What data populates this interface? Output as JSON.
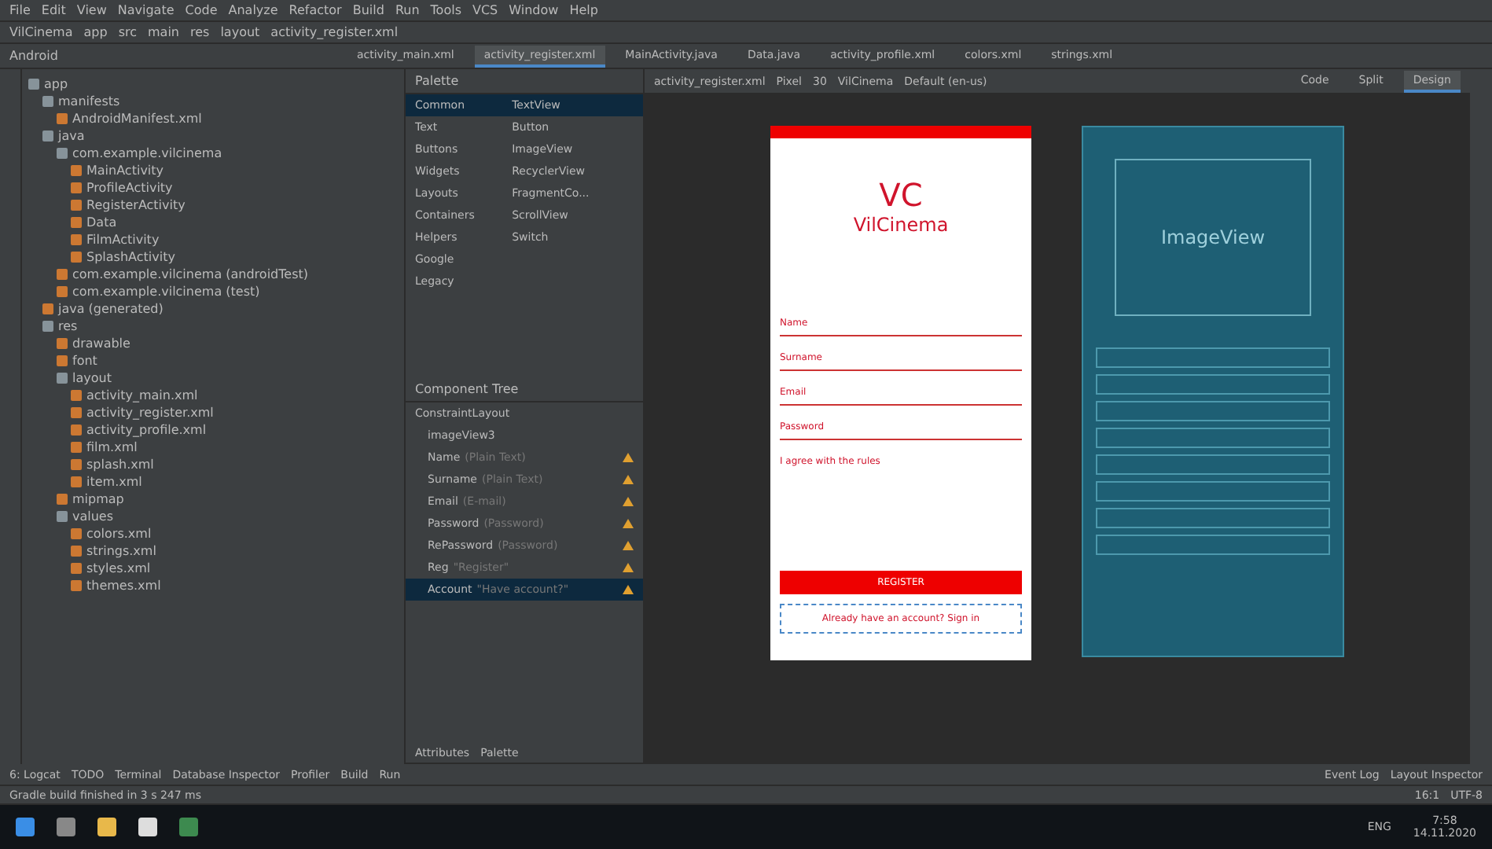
{
  "menu": [
    "File",
    "Edit",
    "View",
    "Navigate",
    "Code",
    "Analyze",
    "Refactor",
    "Build",
    "Run",
    "Tools",
    "VCS",
    "Window",
    "Help"
  ],
  "breadcrumbs": [
    "VilCinema",
    "app",
    "src",
    "main",
    "res",
    "layout",
    "activity_register.xml"
  ],
  "project_view": {
    "label": "Android"
  },
  "editor_tabs": [
    {
      "label": "activity_main.xml",
      "selected": false
    },
    {
      "label": "activity_register.xml",
      "selected": true
    },
    {
      "label": "MainActivity.java",
      "selected": false
    },
    {
      "label": "Data.java",
      "selected": false
    },
    {
      "label": "activity_profile.xml",
      "selected": false
    },
    {
      "label": "colors.xml",
      "selected": false
    },
    {
      "label": "strings.xml",
      "selected": false
    }
  ],
  "view_modes": [
    {
      "label": "Code",
      "selected": false
    },
    {
      "label": "Split",
      "selected": false
    },
    {
      "label": "Design",
      "selected": true
    }
  ],
  "tree": [
    {
      "label": "app",
      "children": [
        {
          "label": "manifests",
          "children": [
            {
              "label": "AndroidManifest.xml"
            }
          ]
        },
        {
          "label": "java",
          "children": [
            {
              "label": "com.example.vilcinema",
              "children": [
                {
                  "label": "MainActivity"
                },
                {
                  "label": "ProfileActivity"
                },
                {
                  "label": "RegisterActivity"
                },
                {
                  "label": "Data"
                },
                {
                  "label": "FilmActivity"
                },
                {
                  "label": "SplashActivity"
                }
              ]
            },
            {
              "label": "com.example.vilcinema (androidTest)"
            },
            {
              "label": "com.example.vilcinema (test)"
            }
          ]
        },
        {
          "label": "java (generated)"
        },
        {
          "label": "res",
          "children": [
            {
              "label": "drawable"
            },
            {
              "label": "font"
            },
            {
              "label": "layout",
              "children": [
                {
                  "label": "activity_main.xml"
                },
                {
                  "label": "activity_register.xml"
                },
                {
                  "label": "activity_profile.xml"
                },
                {
                  "label": "film.xml"
                },
                {
                  "label": "splash.xml"
                },
                {
                  "label": "item.xml"
                }
              ]
            },
            {
              "label": "mipmap"
            },
            {
              "label": "values",
              "children": [
                {
                  "label": "colors.xml"
                },
                {
                  "label": "strings.xml"
                },
                {
                  "label": "styles.xml"
                },
                {
                  "label": "themes.xml"
                }
              ]
            }
          ]
        }
      ]
    }
  ],
  "palette": {
    "title": "Palette",
    "categories": [
      {
        "label": "Common",
        "selected": true
      },
      {
        "label": "Text",
        "selected": false
      },
      {
        "label": "Buttons",
        "selected": false
      },
      {
        "label": "Widgets",
        "selected": false
      },
      {
        "label": "Layouts",
        "selected": false
      },
      {
        "label": "Containers",
        "selected": false
      },
      {
        "label": "Helpers",
        "selected": false
      },
      {
        "label": "Google",
        "selected": false
      },
      {
        "label": "Legacy",
        "selected": false
      }
    ],
    "items": [
      {
        "label": "TextView",
        "selected": true
      },
      {
        "label": "Button",
        "selected": false
      },
      {
        "label": "ImageView",
        "selected": false
      },
      {
        "label": "RecyclerView",
        "selected": false
      },
      {
        "label": "FragmentCo...",
        "selected": false
      },
      {
        "label": "ScrollView",
        "selected": false
      },
      {
        "label": "Switch",
        "selected": false
      }
    ]
  },
  "component_tree": {
    "title": "Component Tree",
    "root": "ConstraintLayout",
    "items": [
      {
        "label": "imageView3",
        "warning": false,
        "selected": false
      },
      {
        "label": "Name",
        "hint": "(Plain Text)",
        "warning": true,
        "selected": false
      },
      {
        "label": "Surname",
        "hint": "(Plain Text)",
        "warning": true,
        "selected": false
      },
      {
        "label": "Email",
        "hint": "(E-mail)",
        "warning": true,
        "selected": false
      },
      {
        "label": "Password",
        "hint": "(Password)",
        "warning": true,
        "selected": false
      },
      {
        "label": "RePassword",
        "hint": "(Password)",
        "warning": true,
        "selected": false
      },
      {
        "label": "Reg",
        "hint": "\"Register\"",
        "warning": true,
        "selected": false
      },
      {
        "label": "Account",
        "hint": "\"Have account?\"",
        "warning": true,
        "selected": true
      }
    ]
  },
  "design_toolbar": {
    "file": "activity_register.xml",
    "device": "Pixel",
    "api": "30",
    "theme": "VilCinema",
    "locale": "Default (en-us)"
  },
  "phone": {
    "logo_mark": "VC",
    "logo_text": "VilCinema",
    "fields": [
      "Name",
      "Surname",
      "Email",
      "Password"
    ],
    "checkbox": "I agree with the rules",
    "button": "REGISTER",
    "link": "Already have an account? Sign in"
  },
  "blueprint": {
    "image_label": "ImageView"
  },
  "bottom_tabs": [
    "Attributes",
    "Palette"
  ],
  "tool_windows": [
    "6: Logcat",
    "TODO",
    "Terminal",
    "Database Inspector",
    "Profiler",
    "Build",
    "Run"
  ],
  "tool_windows_right": [
    "Event Log",
    "Layout Inspector"
  ],
  "status": {
    "message": "Gradle build finished in 3 s 247 ms",
    "position": "16:1",
    "encoding": "UTF-8"
  },
  "taskbar": {
    "time": "7:58",
    "date": "14.11.2020",
    "lang": "ENG"
  }
}
